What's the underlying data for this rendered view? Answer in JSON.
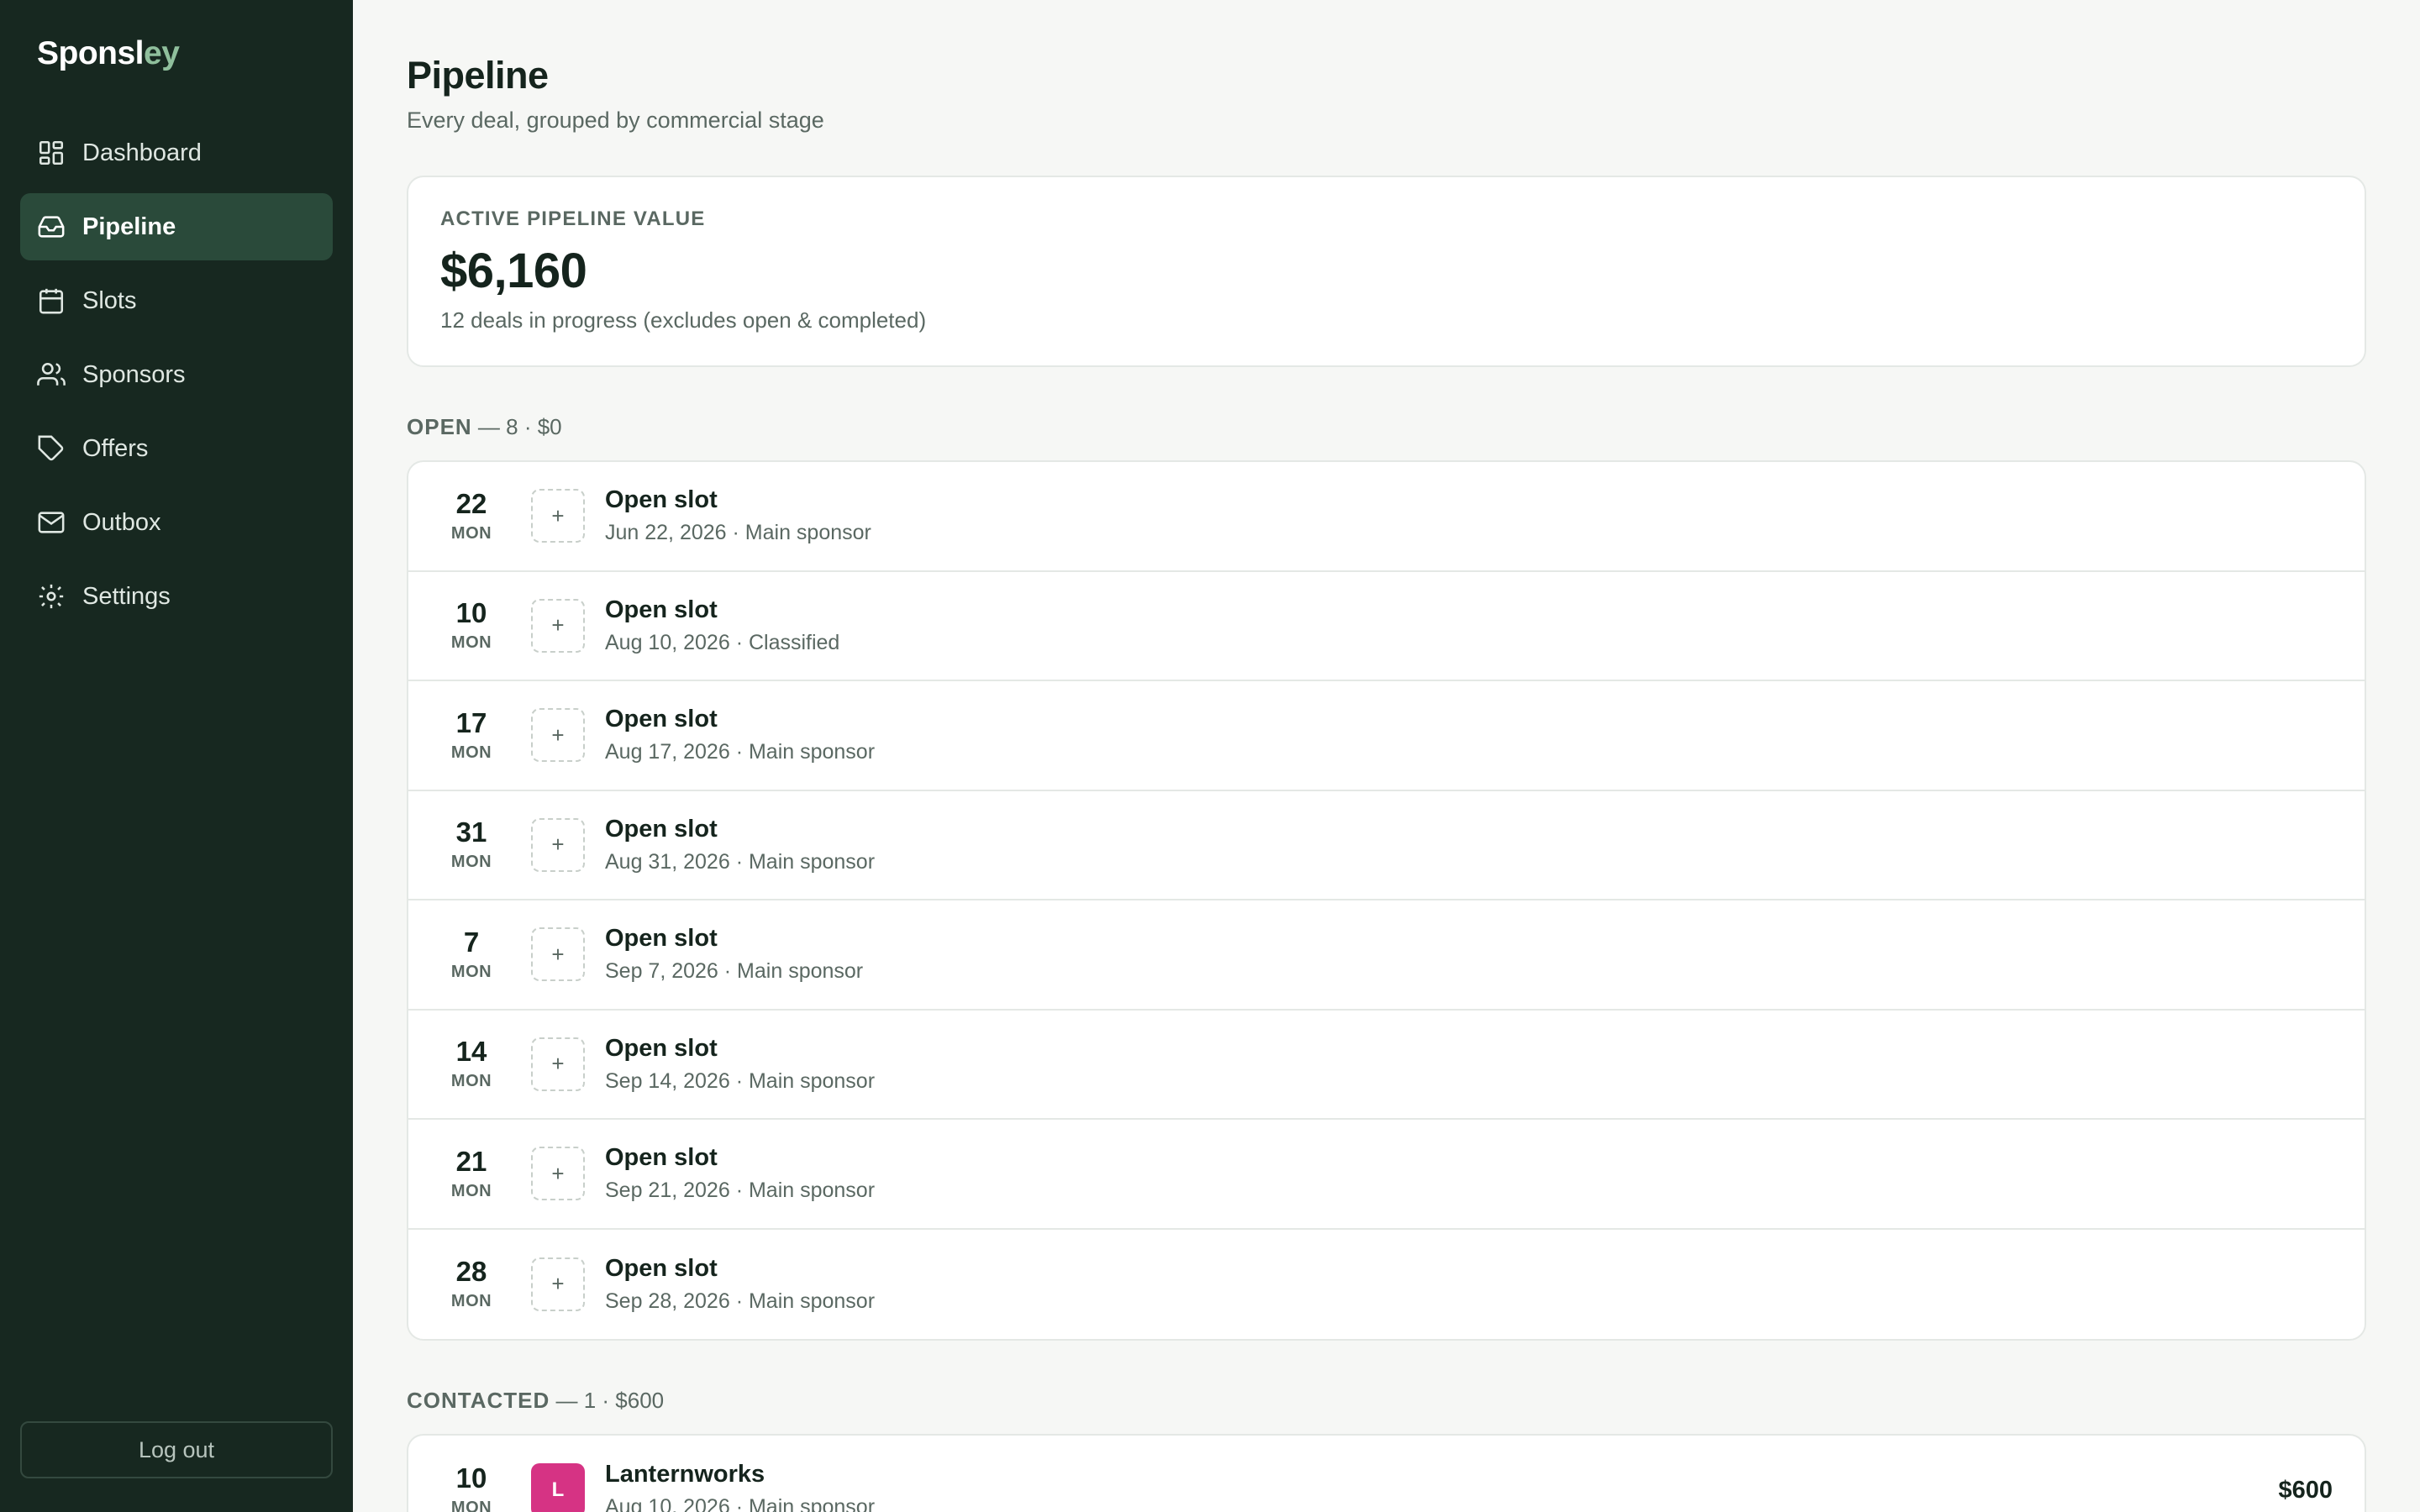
{
  "app": {
    "logo_main": "Spons",
    "logo_mid": "l",
    "logo_accent": "ey"
  },
  "sidebar": {
    "items": [
      {
        "label": "Dashboard",
        "icon": "dashboard-icon"
      },
      {
        "label": "Pipeline",
        "icon": "inbox-icon",
        "active": true
      },
      {
        "label": "Slots",
        "icon": "calendar-icon"
      },
      {
        "label": "Sponsors",
        "icon": "users-icon"
      },
      {
        "label": "Offers",
        "icon": "tag-icon"
      },
      {
        "label": "Outbox",
        "icon": "mail-icon"
      },
      {
        "label": "Settings",
        "icon": "gear-icon"
      }
    ],
    "logout_label": "Log out"
  },
  "header": {
    "title": "Pipeline",
    "subtitle": "Every deal, grouped by commercial stage"
  },
  "summary": {
    "label": "ACTIVE PIPELINE VALUE",
    "amount": "$6,160",
    "note": "12 deals in progress (excludes open & completed)"
  },
  "groups": {
    "open": {
      "stage": "OPEN",
      "count": " — 8 · $0",
      "rows": [
        {
          "day": "22",
          "dow": "MON",
          "icon": "+",
          "title": "Open slot",
          "sub": "Jun 22, 2026 · Main sponsor"
        },
        {
          "day": "10",
          "dow": "MON",
          "icon": "+",
          "title": "Open slot",
          "sub": "Aug 10, 2026 · Classified"
        },
        {
          "day": "17",
          "dow": "MON",
          "icon": "+",
          "title": "Open slot",
          "sub": "Aug 17, 2026 · Main sponsor"
        },
        {
          "day": "31",
          "dow": "MON",
          "icon": "+",
          "title": "Open slot",
          "sub": "Aug 31, 2026 · Main sponsor"
        },
        {
          "day": "7",
          "dow": "MON",
          "icon": "+",
          "title": "Open slot",
          "sub": "Sep 7, 2026 · Main sponsor"
        },
        {
          "day": "14",
          "dow": "MON",
          "icon": "+",
          "title": "Open slot",
          "sub": "Sep 14, 2026 · Main sponsor"
        },
        {
          "day": "21",
          "dow": "MON",
          "icon": "+",
          "title": "Open slot",
          "sub": "Sep 21, 2026 · Main sponsor"
        },
        {
          "day": "28",
          "dow": "MON",
          "icon": "+",
          "title": "Open slot",
          "sub": "Sep 28, 2026 · Main sponsor"
        }
      ]
    },
    "contacted": {
      "stage": "CONTACTED",
      "count": " — 1 · $600",
      "rows": [
        {
          "day": "10",
          "dow": "MON",
          "avatar": "L",
          "avatar_color": "#d63384",
          "title": "Lanternworks",
          "sub": "Aug 10, 2026 · Main sponsor",
          "amount": "$600"
        }
      ]
    }
  }
}
